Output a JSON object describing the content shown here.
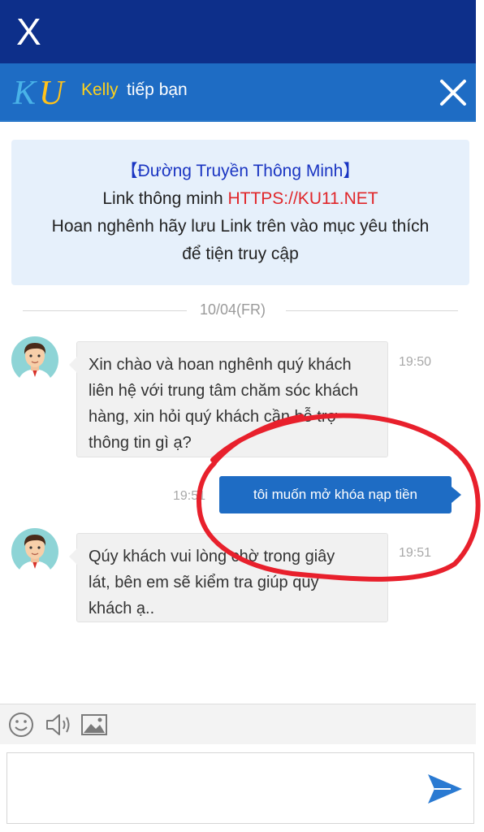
{
  "top_bar": {
    "close_label": "X"
  },
  "header": {
    "agent_name": "Kelly",
    "agent_suffix": "tiếp bạn"
  },
  "notice": {
    "title": "【Đường Truyền Thông Minh】",
    "link_prefix": "Link thông minh ",
    "link_url": "HTTPS://KU11.NET",
    "line3": "Hoan nghênh hãy lưu Link trên vào mục yêu thích",
    "line4": "để tiện truy cập"
  },
  "date_separator": "10/04(FR)",
  "messages": [
    {
      "sender": "agent",
      "lines": [
        "Xin chào và hoan nghênh quý khách",
        "liên hệ với trung tâm chăm sóc khách",
        "hàng, xin hỏi quý khách cần hỗ trợ",
        "thông tin gì ạ?"
      ],
      "time": "19:50"
    },
    {
      "sender": "user",
      "text": "tôi muốn mở khóa nạp tiền",
      "time": "19:51"
    },
    {
      "sender": "agent",
      "lines": [
        "Qúy khách vui lòng chờ trong giây",
        "lát, bên em sẽ kiểm tra giúp quý",
        "khách ạ.."
      ],
      "time": "19:51"
    }
  ],
  "toolbar": {
    "icons": [
      "emoji-icon",
      "voice-icon",
      "image-icon"
    ]
  },
  "input": {
    "placeholder": ""
  },
  "colors": {
    "top_bar": "#0d2f8a",
    "header": "#1e6cc4",
    "agent_name": "#ffd21a",
    "notice_bg": "#e6f0fb",
    "link": "#e0262a",
    "annotation": "#e8202c"
  }
}
